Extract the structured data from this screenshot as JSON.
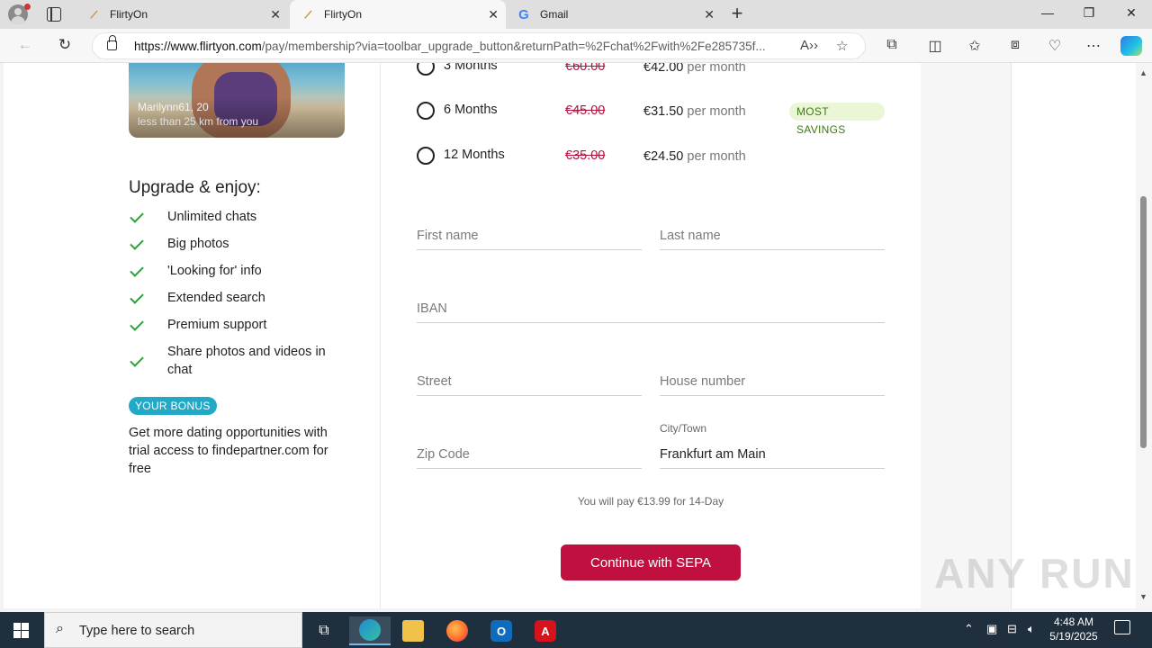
{
  "browser": {
    "tabs": [
      {
        "title": "FlirtyOn",
        "active": false
      },
      {
        "title": "FlirtyOn",
        "active": true
      },
      {
        "title": "Gmail",
        "active": false
      }
    ],
    "url_host": "https://www.flirtyon.com",
    "url_path": "/pay/membership?via=toolbar_upgrade_button&returnPath=%2Fchat%2Fwith%2Fe285735f..."
  },
  "profile_card": {
    "name_age": "Marilynn61, 20",
    "distance": "less than 25 km from you"
  },
  "benefits": {
    "title": "Upgrade & enjoy:",
    "items": [
      "Unlimited chats",
      "Big photos",
      "'Looking for' info",
      "Extended search",
      "Premium support",
      "Share photos and videos in chat"
    ],
    "bonus_badge": "YOUR BONUS",
    "bonus_text": "Get more dating opportunities with trial access to findepartner.com for free"
  },
  "plans": [
    {
      "label": "3 Months",
      "old_price": "€60.00",
      "price": "€42.00",
      "per": "per month",
      "badge": ""
    },
    {
      "label": "6 Months",
      "old_price": "€45.00",
      "price": "€31.50",
      "per": "per month",
      "badge": "MOST SAVINGS"
    },
    {
      "label": "12 Months",
      "old_price": "€35.00",
      "price": "€24.50",
      "per": "per month",
      "badge": ""
    }
  ],
  "form": {
    "first_name": {
      "placeholder": "First name",
      "value": ""
    },
    "last_name": {
      "placeholder": "Last name",
      "value": ""
    },
    "iban": {
      "placeholder": "IBAN",
      "value": ""
    },
    "street": {
      "placeholder": "Street",
      "value": ""
    },
    "house_number": {
      "placeholder": "House number",
      "value": ""
    },
    "zip": {
      "placeholder": "Zip Code",
      "value": ""
    },
    "city": {
      "caption": "City/Town",
      "value": "Frankfurt am Main"
    },
    "pay_note": "You will pay €13.99 for 14-Day",
    "submit_label": "Continue with SEPA"
  },
  "watermark": "ANY RUN",
  "taskbar": {
    "search_placeholder": "Type here to search",
    "time": "4:48 AM",
    "date": "5/19/2025"
  },
  "colors": {
    "accent": "#c0103f",
    "check": "#2e9e3b",
    "bonus": "#22a9c6",
    "savings_bg": "#eaf6d6",
    "taskbar": "#1f2f3d"
  }
}
